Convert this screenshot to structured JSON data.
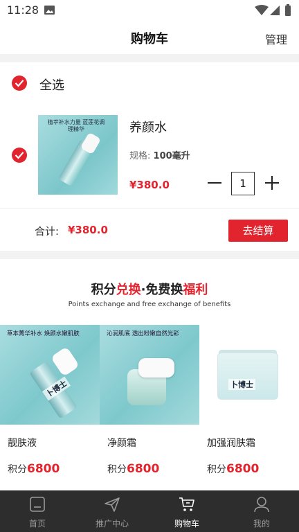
{
  "status_bar": {
    "time": "11:28"
  },
  "header": {
    "title": "购物车",
    "manage": "管理"
  },
  "cart": {
    "select_all": "全选",
    "item": {
      "name": "养颜水",
      "spec_label": "规格:",
      "spec_value": "100毫升",
      "price": "¥380.0",
      "quantity": "1",
      "image_text": "植萃补水力量 蓝莲花调理精华"
    }
  },
  "summary": {
    "total_label": "合计:",
    "total_value": "¥380.0",
    "checkout": "去结算"
  },
  "promo": {
    "title_pre": "积分",
    "title_red1": "兑换",
    "title_mid": "·免费换",
    "title_red2": "福利",
    "subtitle": "Points exchange and free exchange of benefits",
    "points_prefix": "积分",
    "products": [
      {
        "name": "靓肤液",
        "points": "6800",
        "image_text": "草本菁华补水 焕颜水嫩肌肤",
        "brand": "卜博士"
      },
      {
        "name": "净颜霜",
        "points": "6800",
        "image_text": "沁润肌底 透出粉嫩自然光彩",
        "brand": "卜博士"
      },
      {
        "name": "加强润肤霜",
        "points": "6800",
        "brand": "卜博士"
      }
    ]
  },
  "tabbar": {
    "tabs": [
      {
        "label": "首页"
      },
      {
        "label": "推广中心"
      },
      {
        "label": "购物车"
      },
      {
        "label": "我的"
      }
    ]
  },
  "colors": {
    "accent": "#e2242f",
    "tabbar_bg": "#2d2d2d"
  }
}
